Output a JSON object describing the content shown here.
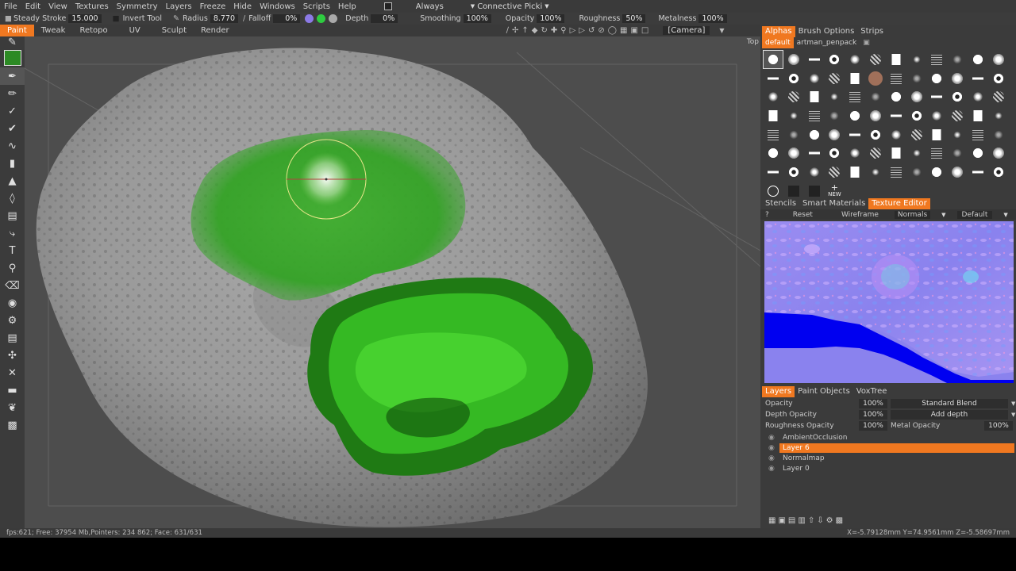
{
  "menubar": {
    "items": [
      "File",
      "Edit",
      "View",
      "Textures",
      "Symmetry",
      "Layers",
      "Freeze",
      "Hide",
      "Windows",
      "Scripts",
      "Help"
    ],
    "always_label": "Always",
    "connective_label": "Connective Picki"
  },
  "toolbar": {
    "steady_stroke_label": "Steady Stroke",
    "steady_stroke_value": "15.000",
    "invert_tool_label": "Invert Tool",
    "radius_label": "Radius",
    "radius_value": "8.770",
    "falloff_label": "Falloff",
    "falloff_value": "0%",
    "depth_label": "Depth",
    "depth_value": "0%",
    "smoothing_label": "Smoothing",
    "smoothing_value": "100%",
    "opacity_label": "Opacity",
    "opacity_value": "100%",
    "roughness_label": "Roughness",
    "roughness_value": "50%",
    "metalness_label": "Metalness",
    "metalness_value": "100%"
  },
  "rooms": {
    "items": [
      "Paint",
      "Tweak",
      "Retopo",
      "UV",
      "Sculpt",
      "Render"
    ],
    "active": "Paint",
    "camera_label": "[Camera]"
  },
  "viewport": {
    "top_label": "Top"
  },
  "right_panel": {
    "top_tabs": [
      "Alphas",
      "Brush Options",
      "Strips"
    ],
    "alpha_sets": [
      "default",
      "artman_penpack"
    ],
    "alpha_new_label": "NEW",
    "mid_tabs": [
      "Stencils",
      "Smart Materials",
      "Texture Editor"
    ],
    "te_controls": {
      "help": "?",
      "reset": "Reset",
      "wireframe": "Wireframe",
      "normals": "Normals",
      "default": "Default"
    },
    "layer_tabs": [
      "Layers",
      "Paint Objects",
      "VoxTree"
    ],
    "layers_props": {
      "opacity_label": "Opacity",
      "opacity_value": "100%",
      "blend_mode": "Standard Blend",
      "depth_opacity_label": "Depth Opacity",
      "depth_opacity_value": "100%",
      "depth_mode": "Add depth",
      "roughness_opacity_label": "Roughness Opacity",
      "roughness_opacity_value": "100%",
      "metal_opacity_label": "Metal Opacity",
      "metal_opacity_value": "100%"
    },
    "layers": [
      "AmbientOcclusion",
      "Layer 6",
      "Normalmap",
      "Layer 0"
    ],
    "active_layer": "Layer 6"
  },
  "statusbar": {
    "left": "fps:621;    Free: 37954 Mb,Pointers: 234 862; Face: 631/631",
    "coords": "X=-5.79128mm  Y=74.9561mm  Z=-5.58697mm"
  },
  "colors": {
    "accent": "#f07820",
    "paint_color": "#2c8a24",
    "panel_bg": "#3b3b3b"
  }
}
